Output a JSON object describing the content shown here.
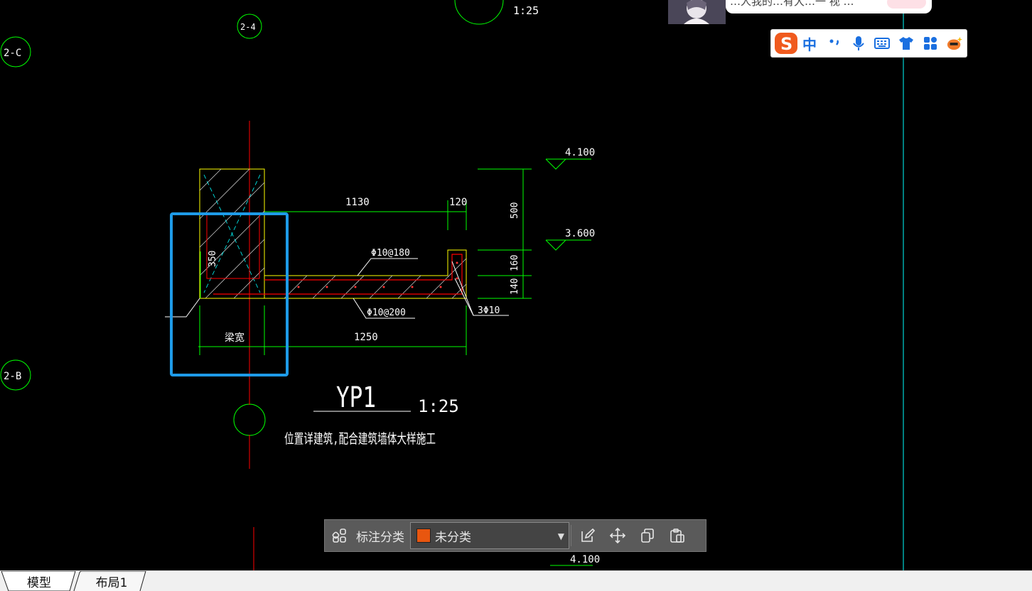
{
  "drawing": {
    "axes": [
      "2-C",
      "2-B",
      "2-4"
    ],
    "top_scale": "1:25",
    "dims": {
      "d1130": "1130",
      "d120": "120",
      "d500": "500",
      "d160": "160",
      "d140": "140",
      "d350": "350",
      "d1250": "1250",
      "beam_width": "梁宽"
    },
    "elevations": [
      "4.100",
      "3.600",
      "4.100"
    ],
    "rebar": {
      "top": "Φ10@180",
      "bottom": "Φ10@200",
      "edge": "3Φ10"
    },
    "title": "YP1",
    "scale": "1:25",
    "note": "位置详建筑,配合建筑墙体大样施工",
    "colors": {
      "background": "#000000",
      "dimension": "#00ff00",
      "centerline": "#ff0000",
      "outline": "#ffff00",
      "hatch": "#ffffff",
      "rebar": "#ff0000",
      "diagonal": "#00ffff",
      "selection": "#1e9be8"
    }
  },
  "ime": {
    "mode": "中",
    "icons": [
      "sogou-logo-icon",
      "punctuation-icon",
      "microphone-icon",
      "keyboard-icon",
      "skin-shirt-icon",
      "toolbox-icon",
      "mascot-icon"
    ]
  },
  "notification": {
    "text": "…人我的…有大…一 视 …"
  },
  "anno_toolbar": {
    "label": "标注分类",
    "category": "未分类",
    "category_color": "#e8560f",
    "icons": [
      "category-grid-icon",
      "edit-icon",
      "move-icon",
      "copy-icon",
      "paste-icon"
    ]
  },
  "tabs": [
    "模型",
    "布局1"
  ]
}
